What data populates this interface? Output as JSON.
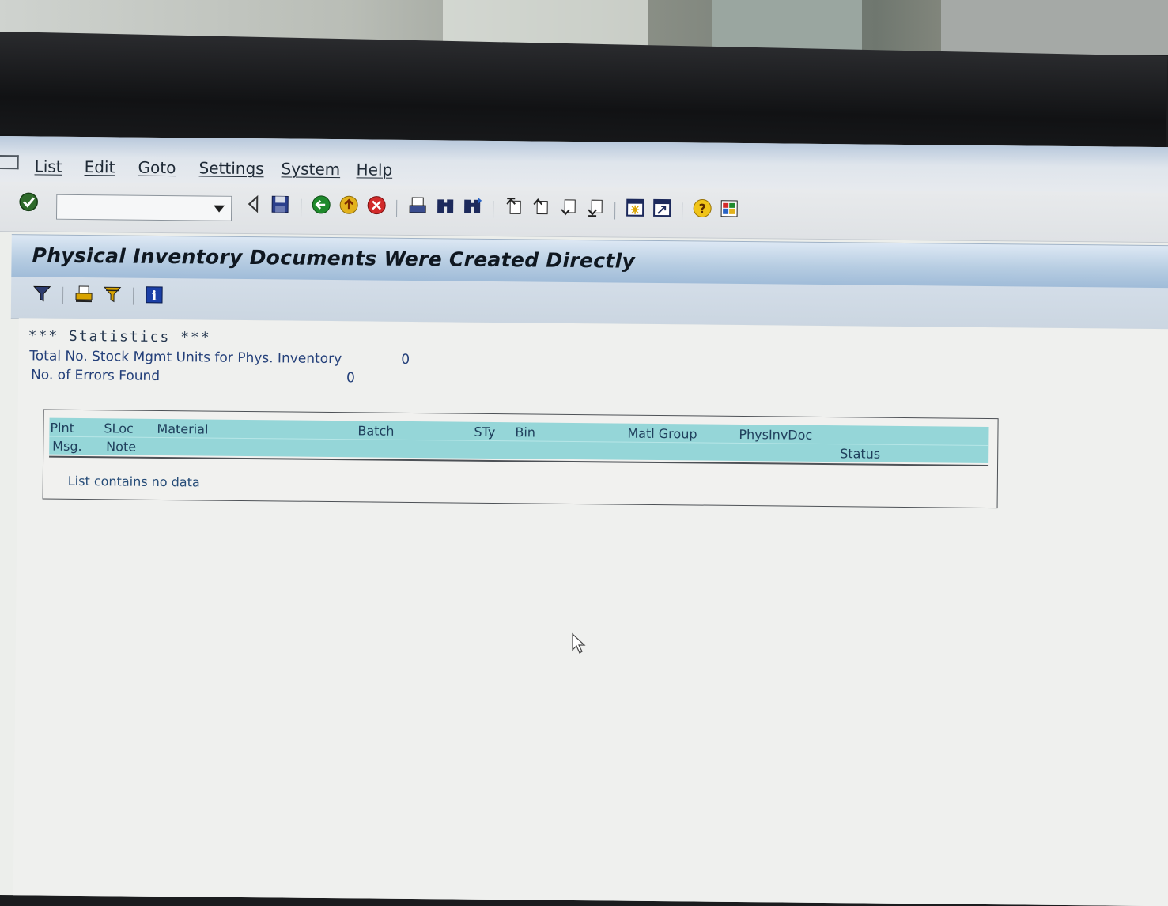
{
  "menu": {
    "items": [
      "List",
      "Edit",
      "Goto",
      "Settings",
      "System",
      "Help"
    ]
  },
  "toolbar": {
    "command_field": {
      "value": "",
      "placeholder": ""
    },
    "icons": [
      "enter-icon",
      "back-nav-icon",
      "save-icon",
      "back-icon",
      "exit-icon",
      "cancel-icon",
      "print-icon",
      "find-icon",
      "find-next-icon",
      "first-page-icon",
      "previous-page-icon",
      "next-page-icon",
      "last-page-icon",
      "new-session-icon",
      "create-shortcut-icon",
      "help-icon",
      "customize-layout-icon"
    ]
  },
  "title": "Physical Inventory Documents Were Created Directly",
  "app_toolbar": {
    "icons": [
      "filter-icon",
      "print-list-icon",
      "subtotal-icon",
      "info-icon"
    ]
  },
  "statistics": {
    "heading": "*** Statistics ***",
    "total_label": "Total No. Stock Mgmt Units for Phys. Inventory",
    "total_value": "0",
    "errors_label": "No. of Errors Found",
    "errors_value": "0"
  },
  "grid": {
    "columns_row1": [
      "Plnt",
      "SLoc",
      "Material",
      "Batch",
      "STy",
      "Bin",
      "Matl Group",
      "PhysInvDoc"
    ],
    "columns_row2": [
      "Msg.",
      "Note",
      "Status"
    ],
    "empty_message": "List contains no data"
  },
  "colors": {
    "title_bar": "#b7cde2",
    "grid_header": "#95d6d8",
    "text_blue": "#24407a"
  }
}
